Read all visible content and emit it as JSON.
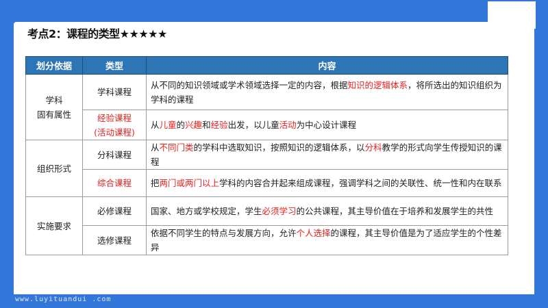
{
  "title": "考点2：课程的类型★★★★★",
  "table": {
    "headers": [
      "划分依据",
      "类型",
      "内容"
    ],
    "groups": [
      {
        "basis": [
          "学科",
          "固有属性"
        ],
        "rows": [
          {
            "type": [
              {
                "t": "学科课程",
                "red": false
              }
            ],
            "content": [
              {
                "t": "从不同的知识领域或学术领域选择一定的内容，根据",
                "red": false
              },
              {
                "t": "知识的逻辑体系",
                "red": true
              },
              {
                "t": "，将所选出的知识组织为学科的课程",
                "red": false
              }
            ]
          },
          {
            "type": [
              {
                "t": "经验课程",
                "red": true
              },
              {
                "t": "(活动课程)",
                "red": true
              }
            ],
            "content": [
              {
                "t": "从",
                "red": false
              },
              {
                "t": "儿童",
                "red": true
              },
              {
                "t": "的",
                "red": false
              },
              {
                "t": "兴趣",
                "red": true
              },
              {
                "t": "和",
                "red": false
              },
              {
                "t": "经验",
                "red": true
              },
              {
                "t": "出发，以儿童",
                "red": false
              },
              {
                "t": "活动",
                "red": true
              },
              {
                "t": "为中心设计课程",
                "red": false
              }
            ]
          }
        ]
      },
      {
        "basis": [
          "组织形式"
        ],
        "rows": [
          {
            "type": [
              {
                "t": "分科课程",
                "red": false
              }
            ],
            "content": [
              {
                "t": "从",
                "red": false
              },
              {
                "t": "不同门类",
                "red": true
              },
              {
                "t": "的学科中选取知识，按照知识的逻辑体系，以",
                "red": false
              },
              {
                "t": "分科",
                "red": true
              },
              {
                "t": "教学的形式向学生传授知识的课程",
                "red": false
              }
            ]
          },
          {
            "type": [
              {
                "t": "综合课程",
                "red": true
              }
            ],
            "content": [
              {
                "t": "把",
                "red": false
              },
              {
                "t": "两门或两门以上",
                "red": true
              },
              {
                "t": "学科的内容合并起来组成课程，强调学科之间的关联性、统一性和内在联系",
                "red": false
              }
            ]
          }
        ]
      },
      {
        "basis": [
          "实施要求"
        ],
        "rows": [
          {
            "type": [
              {
                "t": "必修课程",
                "red": false
              }
            ],
            "content": [
              {
                "t": "国家、地方或学校规定，学生",
                "red": false
              },
              {
                "t": "必须学习",
                "red": true
              },
              {
                "t": "的公共课程，其主导价值在于培养和发展学生的共性",
                "red": false
              }
            ]
          },
          {
            "type": [
              {
                "t": "选修课程",
                "red": false
              }
            ],
            "content": [
              {
                "t": "依据不同学生的特点与发展方向，允许",
                "red": false
              },
              {
                "t": "个人选择",
                "red": true
              },
              {
                "t": "的课程，其主导价值是为了适应学生的个性差异",
                "red": false
              }
            ]
          }
        ]
      }
    ]
  },
  "footer": "www.luyituandui .com",
  "colors": {
    "background": "#3277d9",
    "header": "#2e75b6",
    "highlight": "#e8211f"
  }
}
